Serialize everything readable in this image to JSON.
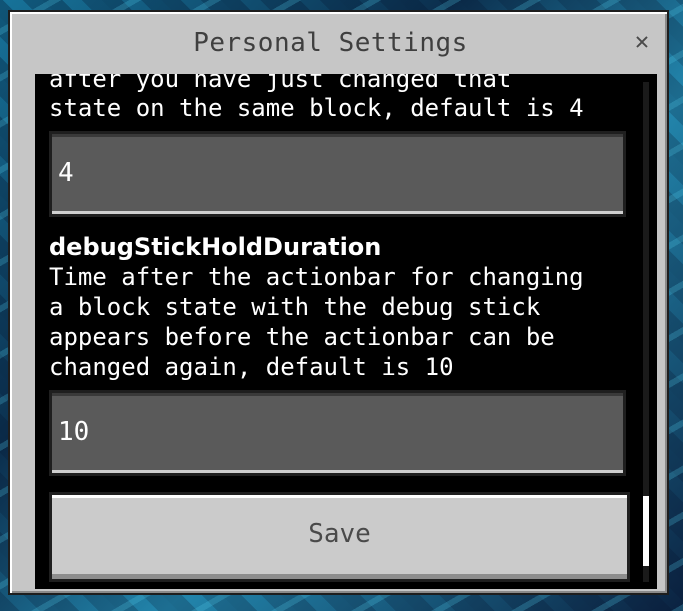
{
  "dialog": {
    "title": "Personal Settings",
    "close_glyph": "✕"
  },
  "settings": {
    "previous": {
      "desc_line_cut": "after you have just changed that",
      "desc_line": "state on the same block, default is 4",
      "value": "4"
    },
    "debug_stick_hold_duration": {
      "name": "debugStickHoldDuration",
      "description_lines": [
        "Time after the actionbar for changing",
        "a block state with the debug stick",
        "appears before the actionbar can be",
        "changed again, default is 10"
      ],
      "value": "10"
    }
  },
  "actions": {
    "save_label": "Save"
  },
  "icons": {
    "close": "close-icon"
  },
  "colors": {
    "dialog_bg": "#c6c6c6",
    "panel_bg": "#000000",
    "field_bg": "#5a5a5a",
    "button_bg": "#cbcbcb"
  }
}
